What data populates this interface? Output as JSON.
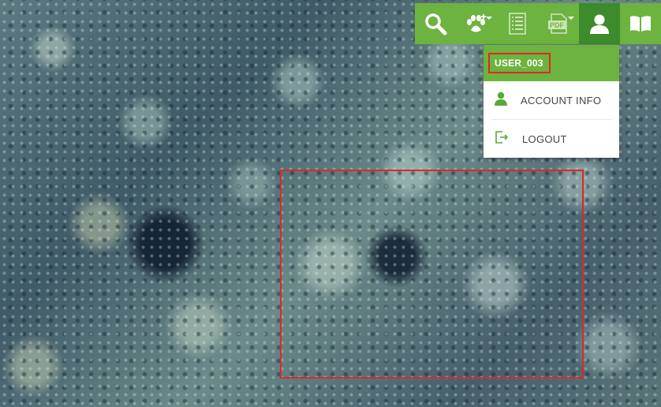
{
  "map": {
    "imagery": "aerial-forest-orthophoto",
    "selection_color": "#e0262b"
  },
  "toolbar": {
    "accent": "#6db33f",
    "active_color": "#3d8b2b",
    "buttons": [
      {
        "icon": "search-icon"
      },
      {
        "icon": "paw-add-icon",
        "dropdown": true
      },
      {
        "icon": "list-document-icon"
      },
      {
        "icon": "pdf-icon",
        "dropdown": true,
        "text": "PDF"
      },
      {
        "icon": "user-icon",
        "active": true
      },
      {
        "icon": "book-icon"
      }
    ]
  },
  "user_menu": {
    "username": "USER_003",
    "items": [
      {
        "label": "ACCOUNT INFO",
        "icon": "person-icon"
      },
      {
        "label": "LOGOUT",
        "icon": "logout-icon"
      }
    ]
  }
}
